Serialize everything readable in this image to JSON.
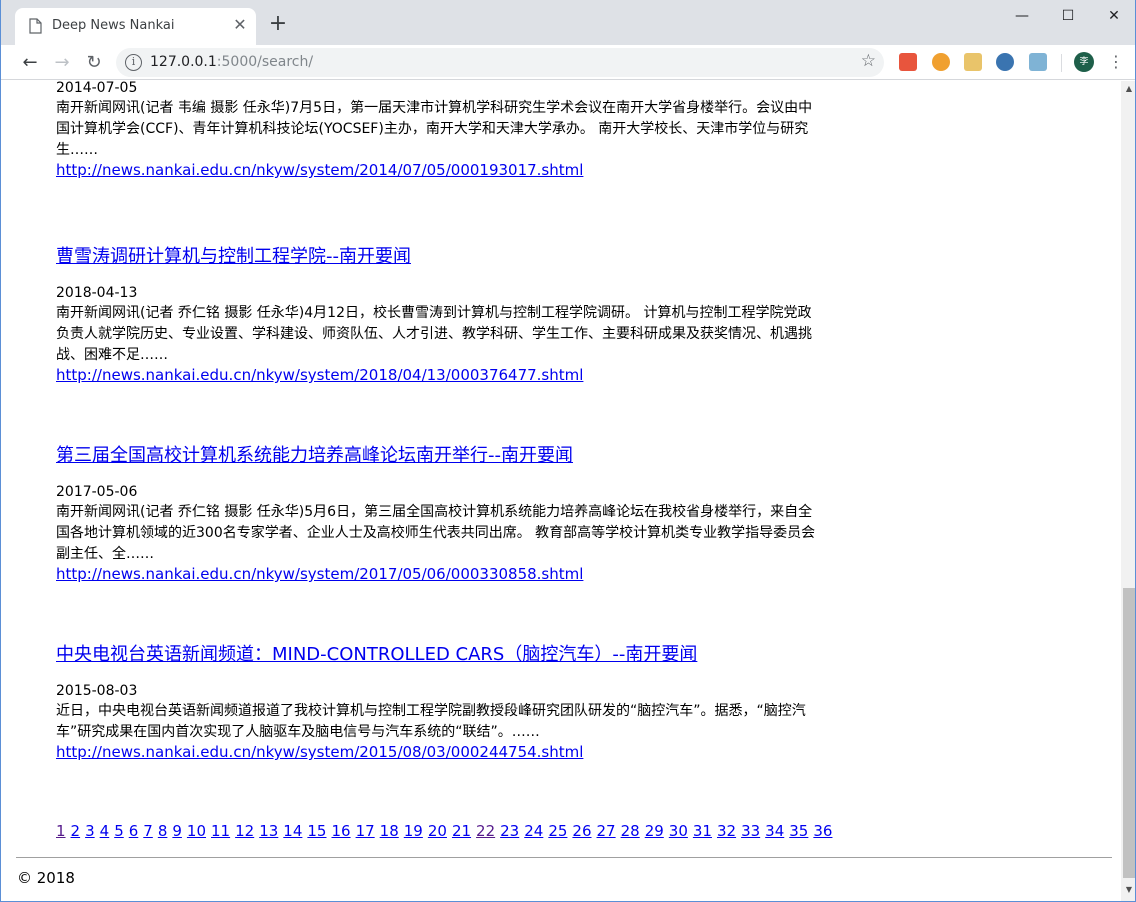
{
  "browser": {
    "tab_title": "Deep News Nankai",
    "tab_close": "✕",
    "new_tab": "+",
    "window": {
      "minimize": "—",
      "maximize": "☐",
      "close": "✕"
    },
    "url_host": "127.0.0.1",
    "url_rest": ":5000/search/",
    "avatar_text": "李"
  },
  "results": [
    {
      "title": "",
      "date": "2014-07-05",
      "snippet": "南开新闻网讯(记者 韦编 摄影 任永华)7月5日，第一届天津市计算机学科研究生学术会议在南开大学省身楼举行。会议由中国计算机学会(CCF)、青年计算机科技论坛(YOCSEF)主办，南开大学和天津大学承办。 南开大学校长、天津市学位与研究生……",
      "link": "http://news.nankai.edu.cn/nkyw/system/2014/07/05/000193017.shtml"
    },
    {
      "title": "曹雪涛调研计算机与控制工程学院--南开要闻",
      "date": "2018-04-13",
      "snippet": "南开新闻网讯(记者 乔仁铭 摄影 任永华)4月12日，校长曹雪涛到计算机与控制工程学院调研。 计算机与控制工程学院党政负责人就学院历史、专业设置、学科建设、师资队伍、人才引进、教学科研、学生工作、主要科研成果及获奖情况、机遇挑战、困难不足……",
      "link": "http://news.nankai.edu.cn/nkyw/system/2018/04/13/000376477.shtml"
    },
    {
      "title": "第三届全国高校计算机系统能力培养高峰论坛南开举行--南开要闻",
      "date": "2017-05-06",
      "snippet": "南开新闻网讯(记者 乔仁铭 摄影 任永华)5月6日，第三届全国高校计算机系统能力培养高峰论坛在我校省身楼举行，来自全国各地计算机领域的近300名专家学者、企业人士及高校师生代表共同出席。 教育部高等学校计算机类专业教学指导委员会副主任、全……",
      "link": "http://news.nankai.edu.cn/nkyw/system/2017/05/06/000330858.shtml"
    },
    {
      "title": "中央电视台英语新闻频道：MIND-CONTROLLED CARS（脑控汽车）--南开要闻",
      "date": "2015-08-03",
      "snippet": "近日，中央电视台英语新闻频道报道了我校计算机与控制工程学院副教授段峰研究团队研发的“脑控汽车”。据悉，“脑控汽车”研究成果在国内首次实现了人脑驱车及脑电信号与汽车系统的“联结”。……",
      "link": "http://news.nankai.edu.cn/nkyw/system/2015/08/03/000244754.shtml"
    }
  ],
  "pagination": {
    "pages": [
      "1",
      "2",
      "3",
      "4",
      "5",
      "6",
      "7",
      "8",
      "9",
      "10",
      "11",
      "12",
      "13",
      "14",
      "15",
      "16",
      "17",
      "18",
      "19",
      "20",
      "21",
      "22",
      "23",
      "24",
      "25",
      "26",
      "27",
      "28",
      "29",
      "30",
      "31",
      "32",
      "33",
      "34",
      "35",
      "36"
    ],
    "visited": [
      "1",
      "22"
    ]
  },
  "footer": "© 2018",
  "colors": {
    "link": "#0000ee",
    "visited": "#551a8b"
  }
}
